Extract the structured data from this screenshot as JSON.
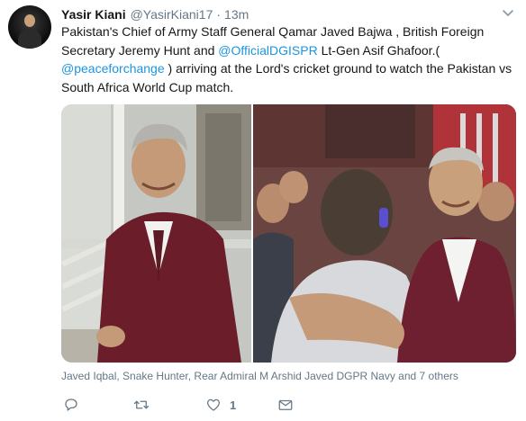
{
  "tweet": {
    "author": {
      "name": "Yasir Kiani",
      "handle": "@YasirKiani17",
      "separator": "·",
      "time": "13m"
    },
    "text_lines": [
      [
        {
          "t": "Pakistan's Chief of Army Staff General Qamar Javed Bajwa , British Foreign",
          "link": false
        }
      ],
      [
        {
          "t": "Secretary Jeremy Hunt and ",
          "link": false
        },
        {
          "t": "@OfficialDGISPR",
          "link": true
        },
        {
          "t": " Lt-Gen Asif Ghafoor.(",
          "link": false
        }
      ],
      [
        {
          "t": "@peaceforchange",
          "link": true
        },
        {
          "t": " ) arriving at the Lord's cricket ground to watch the Pakistan vs",
          "link": false
        }
      ],
      [
        {
          "t": "South Africa World Cup match.",
          "link": false
        }
      ]
    ],
    "liked_by": "Javed Iqbal, Snake Hunter, Rear Admiral M Arshid Javed DGPR Navy and 7 others",
    "actions": {
      "reply_icon": "reply-icon",
      "retweet_icon": "retweet-icon",
      "like_icon": "heart-icon",
      "like_count": "1",
      "dm_icon": "envelope-icon"
    },
    "colors": {
      "link": "#1b95e0",
      "secondary": "#657786",
      "primary": "#14171a"
    }
  }
}
